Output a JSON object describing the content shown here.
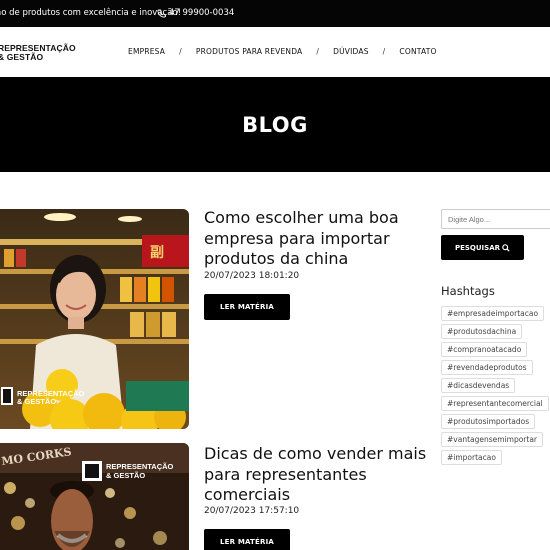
{
  "topbar": {
    "tagline": "ão de produtos com excelência e inovação!",
    "phone": "47 99900-0034"
  },
  "header": {
    "logo_line1": "REPRESENTAÇÃO",
    "logo_line2": "& GESTÃO",
    "nav": [
      "EMPRESA",
      "/",
      "PRODUTOS PARA REVENDA",
      "/",
      "DÚVIDAS",
      "/",
      "CONTATO"
    ]
  },
  "banner": {
    "title": "BLOG"
  },
  "posts": [
    {
      "title": "Como escolher uma boa empresa para importar produtos da china",
      "date": "20/07/2023 18:01:20",
      "button": "LER MATÉRIA",
      "image_logo_line1": "REPRESENTAÇÃO",
      "image_logo_line2": "& GESTÃO",
      "image_sign": "副"
    },
    {
      "title": "Dicas de como vender mais para representantes comerciais",
      "date": "20/07/2023 17:57:10",
      "button": "LER MATÉRIA",
      "image_logo_line1": "REPRESENTAÇÃO",
      "image_logo_line2": "& GESTÃO",
      "image_sign": "MO CORKS"
    }
  ],
  "sidebar": {
    "search_placeholder": "Digite Algo...",
    "search_button": "PESQUISAR",
    "hashtags_title": "Hashtags",
    "tags": [
      "#empresadeimportacao",
      "#produtosdachina",
      "#compranoatacado",
      "#revendadeprodutos",
      "#dicasdevendas",
      "#representantecomercial",
      "#produtosimportados",
      "#vantagensemimportar",
      "#importacao"
    ]
  },
  "colors": {
    "black": "#000000",
    "white": "#ffffff"
  }
}
